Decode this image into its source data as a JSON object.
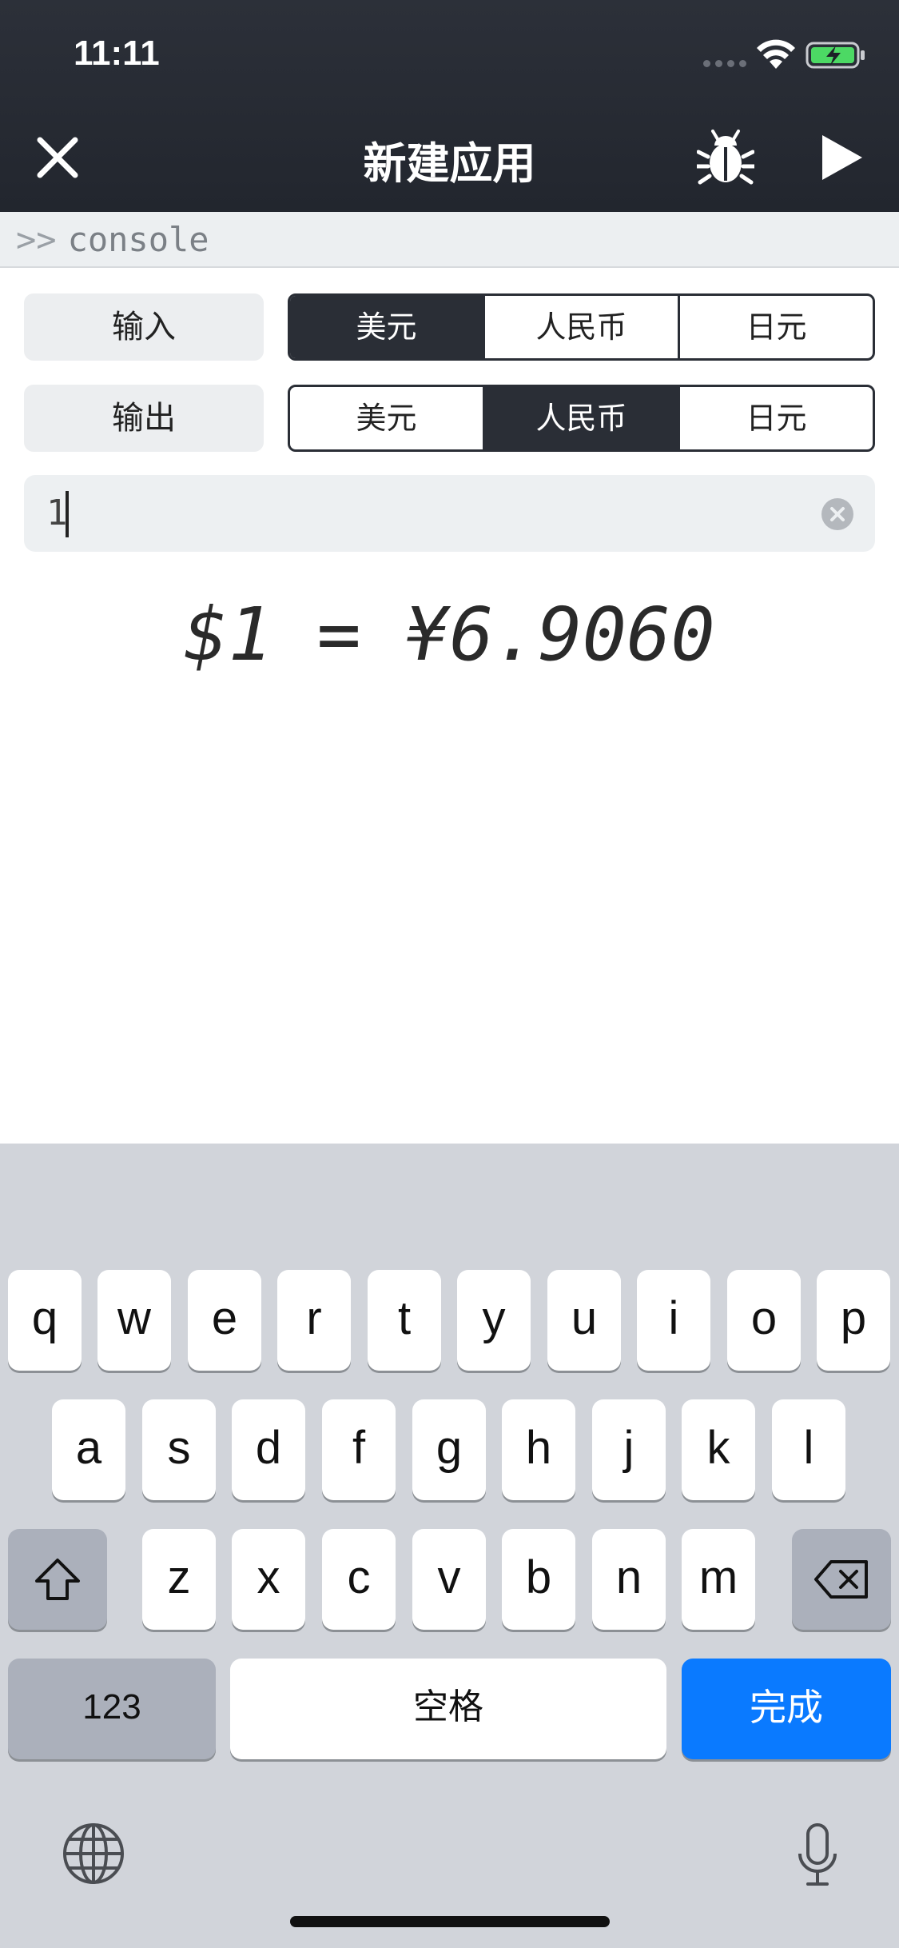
{
  "status_bar": {
    "time": "11:11"
  },
  "header": {
    "title": "新建应用"
  },
  "console": {
    "prompt": ">>",
    "label": "console"
  },
  "input_row": {
    "label": "输入",
    "options": [
      "美元",
      "人民币",
      "日元"
    ],
    "selected": "美元"
  },
  "output_row": {
    "label": "输出",
    "options": [
      "美元",
      "人民币",
      "日元"
    ],
    "selected": "人民币"
  },
  "amount_field": {
    "value": "1"
  },
  "result": {
    "text": "$1 = ¥6.9060"
  },
  "keyboard": {
    "row1": [
      "q",
      "w",
      "e",
      "r",
      "t",
      "y",
      "u",
      "i",
      "o",
      "p"
    ],
    "row2": [
      "a",
      "s",
      "d",
      "f",
      "g",
      "h",
      "j",
      "k",
      "l"
    ],
    "row3": [
      "z",
      "x",
      "c",
      "v",
      "b",
      "n",
      "m"
    ],
    "numbers_key": "123",
    "space_key": "空格",
    "done_key": "完成"
  },
  "colors": {
    "header_bg": "#22262e",
    "accent_blue": "#0a7aff",
    "segment_active": "#2a2e36"
  }
}
